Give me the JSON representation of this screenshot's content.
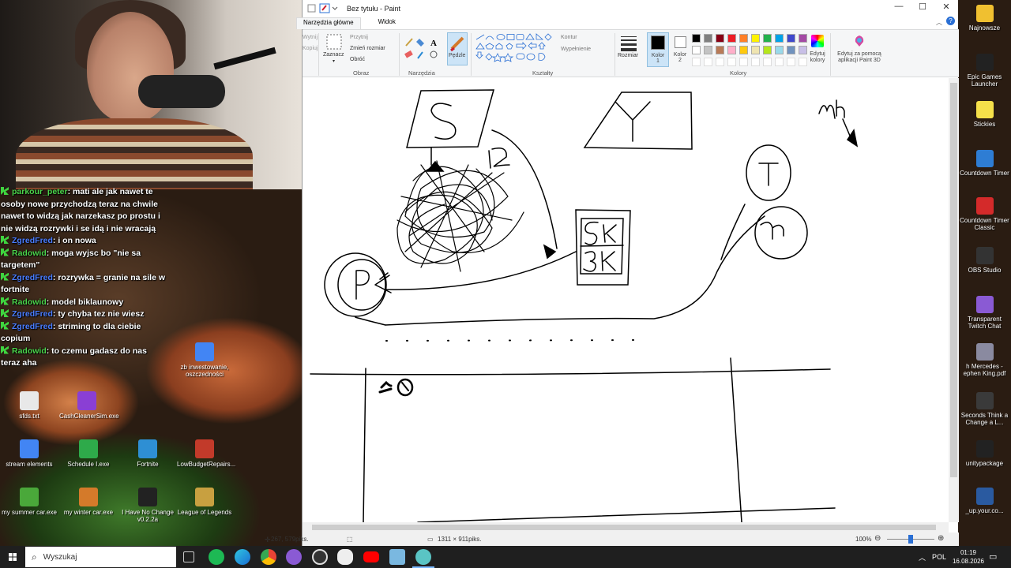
{
  "chat": [
    {
      "user": "parkour_peter",
      "color": "green",
      "text": "mati ale jak nawet te osoby nowe przychodzą teraz na chwile nawet to widzą jak narzekasz po prostu i nie widzą rozrywki i se idą i nie wracają"
    },
    {
      "user": "ZgredFred",
      "color": "blue",
      "text": "i on nowa"
    },
    {
      "user": "Radowid",
      "color": "green",
      "text": "moga wyjsc bo \"nie sa targetem\""
    },
    {
      "user": "ZgredFred",
      "color": "blue",
      "text": "rozrywka = granie na sile w fortnite"
    },
    {
      "user": "Radowid",
      "color": "green",
      "text": "model biklaunowy"
    },
    {
      "user": "ZgredFred",
      "color": "blue",
      "text": "ty chyba tez nie wiesz"
    },
    {
      "user": "ZgredFred",
      "color": "blue",
      "text": "striming to dla ciebie copium"
    },
    {
      "user": "Radowid",
      "color": "green",
      "text": "to czemu gadasz do nas teraz aha"
    }
  ],
  "desktop_icons": [
    {
      "label": "sfds.txt",
      "color": "#e8e8e8"
    },
    {
      "label": "CashCleanerSim.exe",
      "color": "#8a3fd4"
    },
    {
      "label": "stream elements",
      "color": "#4285f4"
    },
    {
      "label": "Schedule I.exe",
      "color": "#2eaa4a"
    },
    {
      "label": "Fortnite",
      "color": "#2e8fd4"
    },
    {
      "label": "LowBudgetRepairs...",
      "color": "#c23a2a"
    },
    {
      "label": "my summer car.exe",
      "color": "#4aa83a"
    },
    {
      "label": "my winter car.exe",
      "color": "#d47a2a"
    },
    {
      "label": "I Have No Change v0.2.2a",
      "color": "#222222"
    },
    {
      "label": "League of Legends",
      "color": "#c8a040"
    },
    {
      "label": "zb inwestowanie, oszczedności",
      "color": "#4285f4"
    }
  ],
  "right_icons": [
    {
      "label": "Najnowsze",
      "color": "#f0c030"
    },
    {
      "label": "Epic Games Launcher",
      "color": "#222222"
    },
    {
      "label": "Stickies",
      "color": "#f5e04a"
    },
    {
      "label": "Countdown Timer",
      "color": "#2e7dd4"
    },
    {
      "label": "Countdown Timer Classic",
      "color": "#d42a2a"
    },
    {
      "label": "OBS Studio",
      "color": "#333333"
    },
    {
      "label": "Transparent Twitch Chat",
      "color": "#8a5ad4"
    },
    {
      "label": "h Mercedes - ephen King.pdf",
      "color": "#8a8aa0"
    },
    {
      "label": "Seconds Think a Change a L...",
      "color": "#3a3a3a"
    },
    {
      "label": "unitypackage",
      "color": "#222222"
    },
    {
      "label": "_up.your.co...",
      "color": "#2a5aa0"
    }
  ],
  "paint": {
    "title": "Bez tytułu - Paint",
    "tabs": [
      "Narzędzia główne",
      "Widok"
    ],
    "ribbon": {
      "wytnij": "Wytnij",
      "kopiuj": "Kopiuj",
      "zaznacz": "Zaznacz",
      "przytnij": "Przytnij",
      "zmien_rozmiar": "Zmień rozmiar",
      "obroc": "Obróć",
      "obraz_label": "Obraz",
      "narzedzia_label": "Narzędzia",
      "pedzle": "Pędzle",
      "ksztalty_label": "Kształty",
      "kontur": "Kontur",
      "wypelnienie": "Wypełnienie",
      "rozmiar": "Rozmiar",
      "kolor1": "Kolor 1",
      "kolor2": "Kolor 2",
      "kolory_label": "Kolory",
      "edytuj_kolory": "Edytuj kolory",
      "paint3d": "Edytuj za pomocą aplikacji Paint 3D"
    },
    "palette": [
      "#000000",
      "#7f7f7f",
      "#880015",
      "#ed1c24",
      "#ff7f27",
      "#fff200",
      "#22b14c",
      "#00a2e8",
      "#3f48cc",
      "#a349a4",
      "#ffffff",
      "#c3c3c3",
      "#b97a57",
      "#ffaec9",
      "#ffc90e",
      "#efe4b0",
      "#b5e61d",
      "#99d9ea",
      "#7092be",
      "#c8bfe7"
    ],
    "status": {
      "cursor": "267, 579piks.",
      "size": "1311 × 911piks.",
      "zoom": "100%"
    }
  },
  "taskbar": {
    "search_placeholder": "Wyszukaj",
    "lang": "POL",
    "time": "01:19",
    "date": "16.08.2026"
  }
}
